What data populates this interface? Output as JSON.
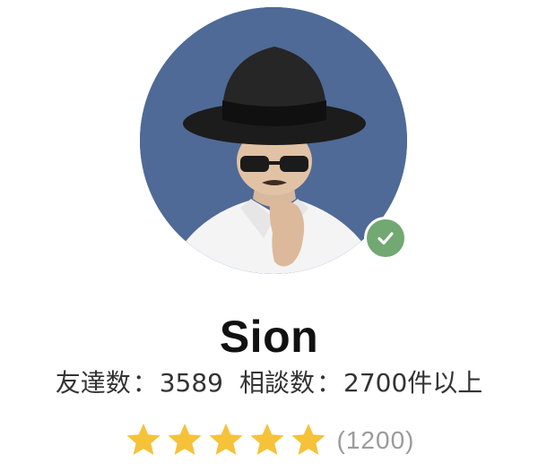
{
  "profile": {
    "name": "Sion",
    "verified": true,
    "avatar_icon": "person-avatar-icon",
    "verified_icon": "check-icon",
    "colors": {
      "avatar_bg": "#4f6a96",
      "badge": "#72a872",
      "star": "#f5c23a"
    }
  },
  "stats": {
    "friends_label": "友達数",
    "separator": "：",
    "friends_value": "3589",
    "consult_label": "相談数",
    "consult_value": "2700件以上"
  },
  "rating": {
    "value": 5,
    "max": 5,
    "count_text": "(1200)"
  }
}
